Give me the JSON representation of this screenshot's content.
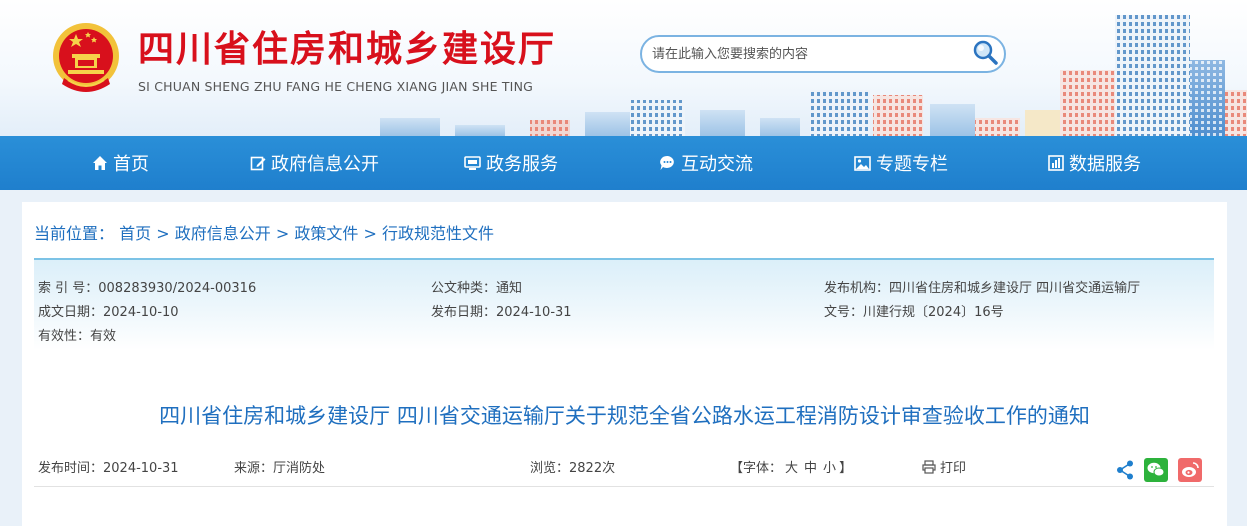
{
  "header": {
    "title": "四川省住房和城乡建设厅",
    "subtitle": "SI CHUAN SHENG ZHU FANG HE CHENG XIANG JIAN SHE TING",
    "brand_color": "#d8101c",
    "search": {
      "placeholder": "请在此输入您要搜索的内容",
      "icon": "search-icon"
    }
  },
  "nav": {
    "items": [
      {
        "label": "首页",
        "icon": "home-icon"
      },
      {
        "label": "政府信息公开",
        "icon": "edit-icon"
      },
      {
        "label": "政务服务",
        "icon": "service-icon"
      },
      {
        "label": "互动交流",
        "icon": "chat-icon"
      },
      {
        "label": "专题专栏",
        "icon": "image-icon"
      },
      {
        "label": "数据服务",
        "icon": "data-icon"
      }
    ],
    "bg_color": "#2286d3"
  },
  "breadcrumb": {
    "label": "当前位置：",
    "items": [
      "首页",
      "政府信息公开",
      "政策文件",
      "行政规范性文件"
    ],
    "separator": ">"
  },
  "meta": {
    "index_no": "索 引 号：008283930/2024-00316",
    "doc_type": "公文种类：通知",
    "issuer": "发布机构：四川省住房和城乡建设厅 四川省交通运输厅",
    "created_date": "成文日期：2024-10-10",
    "publish_date": "发布日期：2024-10-31",
    "doc_no": "文号：川建行规〔2024〕16号",
    "validity": "有效性：有效"
  },
  "article": {
    "title": "四川省住房和城乡建设厅 四川省交通运输厅关于规范全省公路水运工程消防设计审查验收工作的通知",
    "published": "发布时间：2024-10-31",
    "source": "来源：厅消防处",
    "views": "浏览：2822次",
    "font_size": {
      "prefix": "【字体：",
      "large": "大",
      "medium": "中",
      "small": "小",
      "suffix": "】"
    },
    "print_label": "打印",
    "share_icons": [
      "share-icon",
      "wechat-icon",
      "weibo-icon"
    ]
  }
}
